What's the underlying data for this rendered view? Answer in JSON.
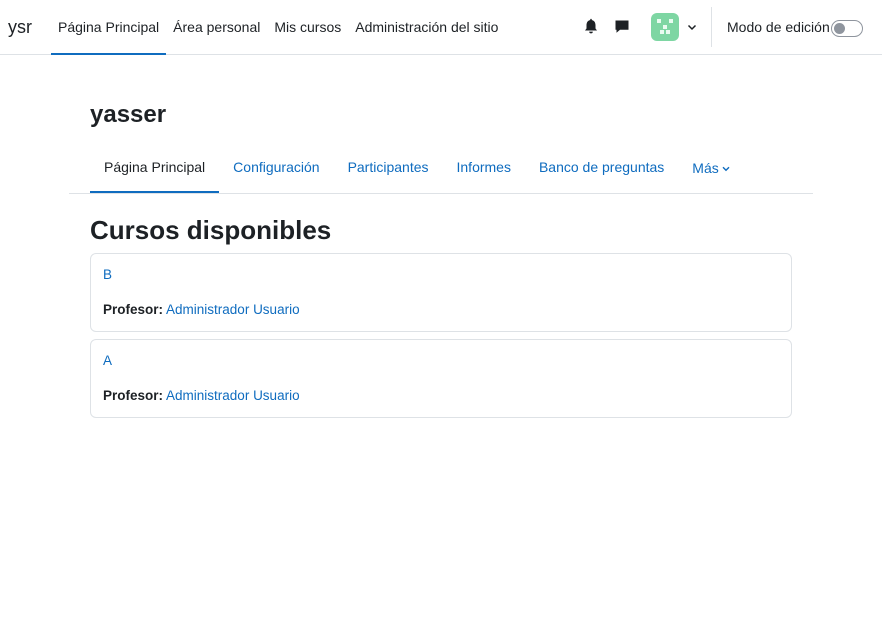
{
  "navbar": {
    "brand": "ysr",
    "items": [
      {
        "label": "Página Principal",
        "active": true
      },
      {
        "label": "Área personal",
        "active": false
      },
      {
        "label": "Mis cursos",
        "active": false
      },
      {
        "label": "Administración del sitio",
        "active": false
      }
    ],
    "icons": {
      "notifications": "bell-icon",
      "messages": "chat-bubble-icon",
      "user_menu": "chevron-down-icon"
    },
    "avatar_color": "#7ed6a3",
    "edit_mode_label": "Modo de edición",
    "edit_mode_on": false
  },
  "page": {
    "title": "yasser",
    "secondary_nav": [
      {
        "label": "Página Principal",
        "active": true
      },
      {
        "label": "Configuración",
        "active": false
      },
      {
        "label": "Participantes",
        "active": false
      },
      {
        "label": "Informes",
        "active": false
      },
      {
        "label": "Banco de preguntas",
        "active": false
      },
      {
        "label": "Más",
        "active": false,
        "icon": "chevron-down-icon"
      }
    ]
  },
  "courses": {
    "heading": "Cursos disponibles",
    "list": [
      {
        "name": "B",
        "teacher_label": "Profesor:",
        "teacher_name": "Administrador Usuario"
      },
      {
        "name": "A",
        "teacher_label": "Profesor:",
        "teacher_name": "Administrador Usuario"
      }
    ]
  },
  "colors": {
    "link": "#0f6cbf",
    "text": "#1d2125",
    "border": "#dee2e6"
  }
}
